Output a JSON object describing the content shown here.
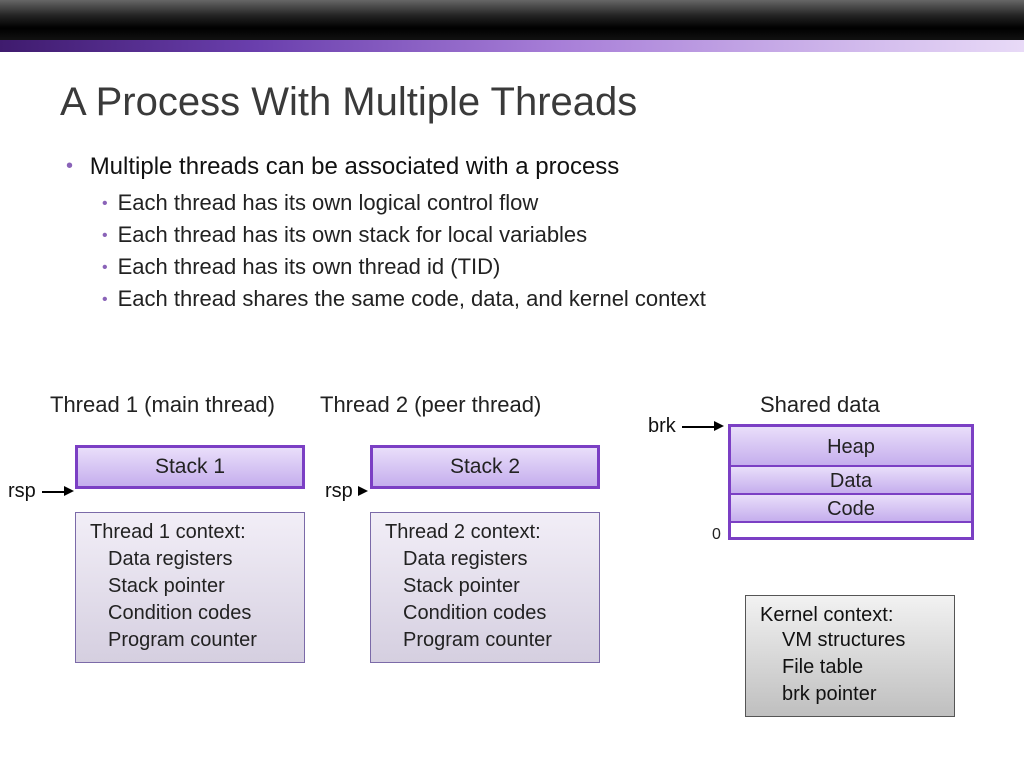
{
  "title": "A Process With Multiple Threads",
  "bullet_main": "Multiple threads can be associated with a process",
  "subbullets": [
    "Each thread has its own logical control flow",
    "Each thread has its own stack for local variables",
    "Each thread has its own thread id (TID)",
    "Each thread shares the same code, data, and kernel context"
  ],
  "thread1_title": "Thread 1 (main thread)",
  "thread2_title": "Thread 2 (peer thread)",
  "shared_title": "Shared data",
  "stack1": "Stack 1",
  "stack2": "Stack 2",
  "rsp": "rsp",
  "brk": "brk",
  "zero": "0",
  "shared_segments": {
    "heap": "Heap",
    "data": "Data",
    "code": "Code"
  },
  "context1": {
    "title": "Thread 1 context:",
    "items": [
      "Data registers",
      "Stack pointer",
      "Condition codes",
      "Program counter"
    ]
  },
  "context2": {
    "title": "Thread 2 context:",
    "items": [
      "Data registers",
      "Stack pointer",
      "Condition codes",
      "Program counter"
    ]
  },
  "kernel": {
    "title": "Kernel context:",
    "items": [
      "VM structures",
      "File table",
      "brk pointer"
    ]
  }
}
